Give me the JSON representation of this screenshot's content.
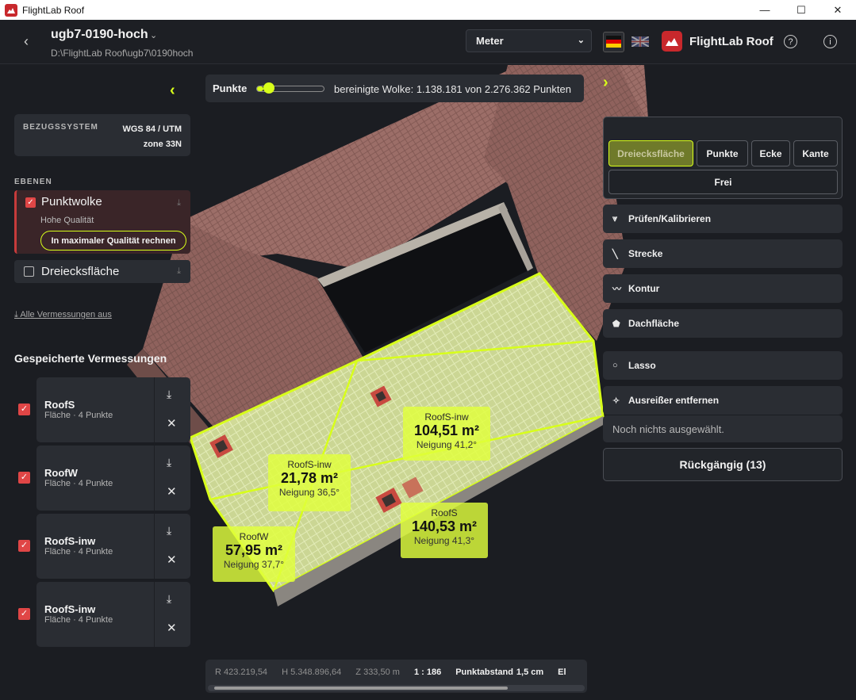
{
  "window": {
    "title": "FlightLab Roof",
    "controls": [
      "—",
      "☐",
      "✕"
    ]
  },
  "header": {
    "back": "‹",
    "project_name": "ugb7-0190-hoch",
    "project_path": "D:\\FlightLab Roof\\ugb7\\0190hoch",
    "unit": "Meter",
    "brand": "FlightLab Roof",
    "help": "?",
    "info": "i"
  },
  "left": {
    "reference": {
      "label": "BEZUGSSYSTEM",
      "value_line1": "WGS 84 / UTM",
      "value_line2": "zone 33N"
    },
    "layers_title": "EBENEN",
    "layers": [
      {
        "name": "Punktwolke",
        "checked": true,
        "quality": "Hohe Qualität",
        "action": "In maximaler Qualität rechnen"
      },
      {
        "name": "Dreiecksfläche",
        "checked": false
      }
    ],
    "download_all": "Alle Vermessungen aus",
    "saved_title": "Gespeicherte Vermessungen",
    "measurements": [
      {
        "name": "RoofS",
        "desc": "Fläche · 4 Punkte"
      },
      {
        "name": "RoofW",
        "desc": "Fläche · 4 Punkte"
      },
      {
        "name": "RoofS-inw",
        "desc": "Fläche · 4 Punkte"
      },
      {
        "name": "RoofS-inw",
        "desc": "Fläche · 4 Punkte"
      }
    ]
  },
  "points_bar": {
    "label": "Punkte",
    "slider_fraction": 0.1,
    "text": "bereinigte Wolke: 1.138.181 von 2.276.362 Punkten"
  },
  "right": {
    "modes": [
      "Dreiecksfläche",
      "Punkte",
      "Ecke",
      "Kante"
    ],
    "active_mode": "Dreiecksfläche",
    "free_mode": "Frei",
    "tools": [
      {
        "icon": "check-calibrate-icon",
        "glyph": "⩔",
        "label": "Prüfen/Kalibrieren"
      },
      {
        "icon": "ruler-icon",
        "glyph": "╲",
        "label": "Strecke"
      },
      {
        "icon": "contour-icon",
        "glyph": "〰",
        "label": "Kontur"
      },
      {
        "icon": "roof-area-icon",
        "glyph": "⬟",
        "label": "Dachfläche"
      },
      {
        "icon": "lasso-icon",
        "glyph": "○",
        "label": "Lasso"
      },
      {
        "icon": "outlier-icon",
        "glyph": "✧",
        "label": "Ausreißer entfernen"
      }
    ],
    "empty_selection": "Noch nichts ausgewählt.",
    "undo": "Rückgängig (13)"
  },
  "viewport_labels": [
    {
      "title": "RoofS-inw",
      "area": "104,51 m²",
      "slope": "Neigung 41,2°"
    },
    {
      "title": "RoofS-inw",
      "area": "21,78 m²",
      "slope": "Neigung 36,5°"
    },
    {
      "title": "RoofS",
      "area": "140,53 m²",
      "slope": "Neigung 41,3°"
    },
    {
      "title": "RoofW",
      "area": "57,95 m²",
      "slope": "Neigung 37,7°"
    }
  ],
  "status": {
    "r": "R 423.219,54",
    "h": "H 5.348.896,64",
    "z": "Z 333,50 m",
    "scale": "1 : 186",
    "spacing_label": "Punktabstand",
    "spacing_value": "1,5 cm",
    "extra": "El"
  },
  "colors": {
    "accent": "#d8ff1a",
    "brand_red": "#c8282c",
    "background": "#1b1d22"
  }
}
